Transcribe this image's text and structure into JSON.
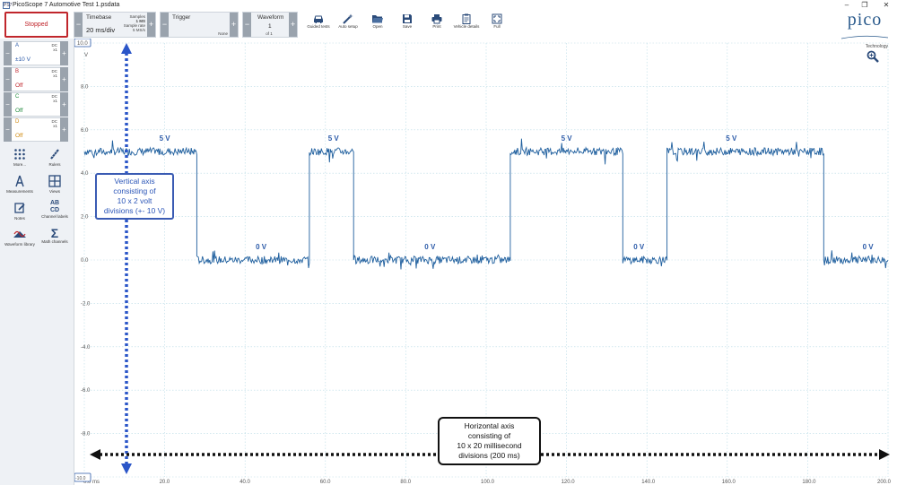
{
  "window": {
    "title": "PicoScope 7 Automotive Test 1.psdata",
    "app_icon": "PS7"
  },
  "toolbar": {
    "run_state": "Stopped",
    "timebase": {
      "label": "Timebase",
      "value": "20 ms/div",
      "samples_label": "Samples",
      "samples_value": "1 MS",
      "rate_label": "Sample rate",
      "rate_value": "5 MS/s"
    },
    "trigger": {
      "label": "Trigger",
      "mode": "None"
    },
    "waveform": {
      "label": "Waveform",
      "value": "1",
      "of": "of 1"
    },
    "buttons": [
      {
        "label": "Guided tests",
        "icon": "car-icon"
      },
      {
        "label": "Auto setup",
        "icon": "wand-icon"
      },
      {
        "label": "Open",
        "icon": "folder-icon"
      },
      {
        "label": "Save",
        "icon": "save-icon"
      },
      {
        "label": "Print",
        "icon": "print-icon"
      },
      {
        "label": "Vehicle details",
        "icon": "clipboard-icon"
      },
      {
        "label": "Full",
        "icon": "fullscreen-icon"
      }
    ]
  },
  "logo": {
    "brand": "pico",
    "sub": "Technology"
  },
  "channels": [
    {
      "name": "A",
      "range": "±10 V",
      "coupling": "DC",
      "probe": "x1",
      "color": "#2b5aa8"
    },
    {
      "name": "B",
      "range": "Off",
      "coupling": "DC",
      "probe": "x1",
      "color": "#c0262c"
    },
    {
      "name": "C",
      "range": "Off",
      "coupling": "DC",
      "probe": "x1",
      "color": "#1f8a3c"
    },
    {
      "name": "D",
      "range": "Off",
      "coupling": "DC",
      "probe": "x1",
      "color": "#d08a10"
    }
  ],
  "tools": [
    {
      "label": "More...",
      "icon": "dots-grid-icon"
    },
    {
      "label": "Rulers",
      "icon": "ruler-icon"
    },
    {
      "label": "Measurements",
      "icon": "measure-icon"
    },
    {
      "label": "Views",
      "icon": "views-grid-icon"
    },
    {
      "label": "Notes",
      "icon": "notes-icon"
    },
    {
      "label": "Channel labels",
      "icon": "abcd-icon"
    },
    {
      "label": "Waveform library",
      "icon": "library-icon"
    },
    {
      "label": "Math channels",
      "icon": "sigma-icon"
    }
  ],
  "scope": {
    "y_unit": "V",
    "y_top_label": "10.0",
    "y_bottom_label": "-10.0",
    "y_ticks": [
      "8.0",
      "6.0",
      "4.0",
      "2.0",
      "0.0",
      "-2.0",
      "-4.0",
      "-6.0",
      "-8.0"
    ],
    "x_start_label": "0.0 ms",
    "x_ticks": [
      "20.0",
      "40.0",
      "60.0",
      "80.0",
      "100.0",
      "120.0",
      "140.0",
      "160.0",
      "180.0",
      "200.0"
    ],
    "level_labels": [
      {
        "text": "5 V",
        "t": 20
      },
      {
        "text": "5 V",
        "t": 62
      },
      {
        "text": "5 V",
        "t": 120
      },
      {
        "text": "5 V",
        "t": 161
      },
      {
        "text": "0 V",
        "t": 44
      },
      {
        "text": "0 V",
        "t": 86
      },
      {
        "text": "0 V",
        "t": 138
      },
      {
        "text": "0 V",
        "t": 195
      }
    ],
    "segments": [
      {
        "t0": 0,
        "t1": 28,
        "v": 5
      },
      {
        "t0": 28,
        "t1": 56,
        "v": 0
      },
      {
        "t0": 56,
        "t1": 67,
        "v": 5
      },
      {
        "t0": 67,
        "t1": 106,
        "v": 0
      },
      {
        "t0": 106,
        "t1": 134,
        "v": 5
      },
      {
        "t0": 134,
        "t1": 145,
        "v": 0
      },
      {
        "t0": 145,
        "t1": 184,
        "v": 5
      },
      {
        "t0": 184,
        "t1": 200,
        "v": 0
      }
    ],
    "trace_color": "#1f5f9e"
  },
  "annotations": {
    "vertical": [
      "Vertical axis",
      "consisting of",
      "10 x 2 volt",
      "divisions (+- 10 V)"
    ],
    "horizontal": [
      "Horizontal axis",
      "consisting of",
      "10 x 20 millisecond",
      "divisions  (200 ms)"
    ]
  }
}
